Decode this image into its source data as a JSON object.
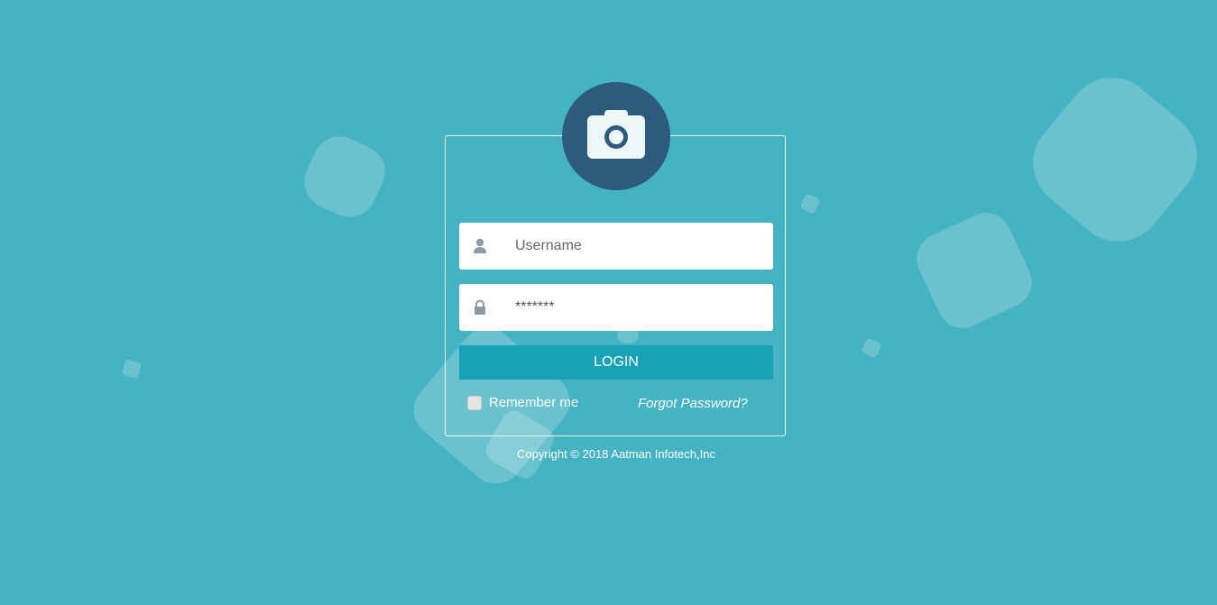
{
  "login": {
    "username_placeholder": "Username",
    "password_value": "*******",
    "login_button_label": "LOGIN",
    "remember_label": "Remember me",
    "forgot_link": "Forgot Password?"
  },
  "footer": {
    "copyright": "Copyright © 2018 Aatman Infotech,Inc"
  },
  "icons": {
    "logo": "camera-icon",
    "username": "user-icon",
    "password": "lock-icon"
  },
  "colors": {
    "background": "#45b3c3",
    "logo_circle": "#2e5b7c",
    "button": "#18a1b7"
  }
}
